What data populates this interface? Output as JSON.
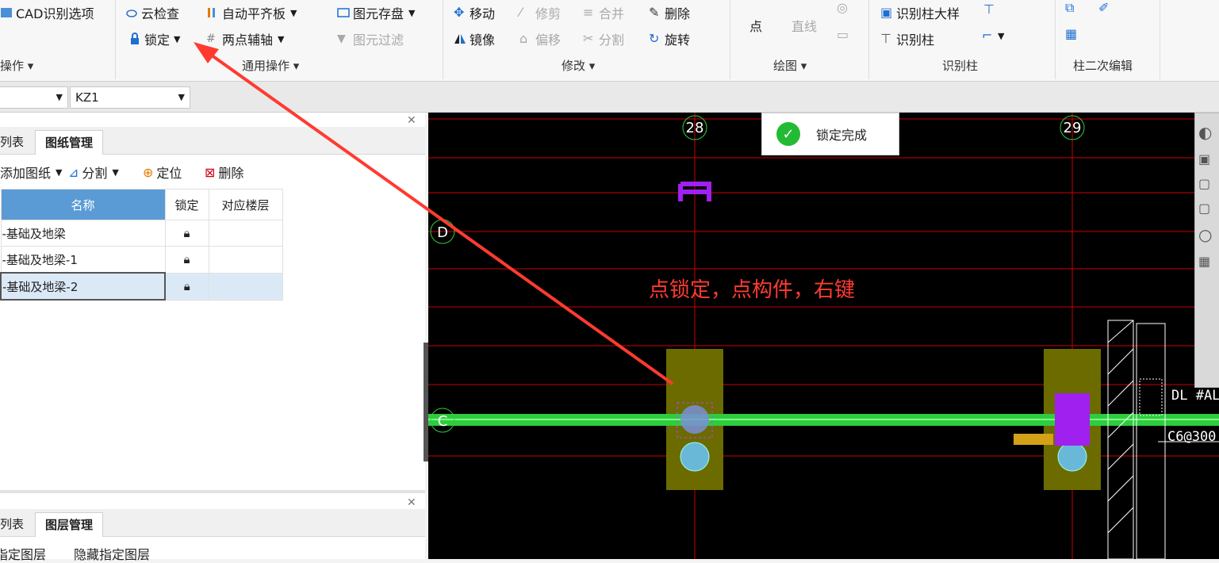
{
  "ribbon": {
    "col1": {
      "cad_options": "CAD识别选项",
      "group_partial": "操作"
    },
    "col2": {
      "cloud_check": "云检查",
      "lock": "锁定",
      "auto_align": "自动平齐板",
      "two_point_axis": "两点辅轴",
      "store_elements": "图元存盘",
      "filter_elements": "图元过滤",
      "group": "通用操作"
    },
    "modify": {
      "move": "移动",
      "trim": "修剪",
      "merge": "合并",
      "delete": "删除",
      "mirror": "镜像",
      "offset": "偏移",
      "split": "分割",
      "rotate": "旋转",
      "group": "修改"
    },
    "draw": {
      "point": "点",
      "line": "直线",
      "group": "绘图"
    },
    "recognize": {
      "column_detail": "识别柱大样",
      "column": "识别柱",
      "group": "识别柱"
    },
    "edit2": {
      "group": "柱二次编辑"
    }
  },
  "selector": {
    "component": "KZ1"
  },
  "drawings_panel": {
    "tab_list": "列表",
    "tab_manage": "图纸管理",
    "add": "添加图纸",
    "split": "分割",
    "locate": "定位",
    "delete": "删除",
    "headers": [
      "名称",
      "锁定",
      "对应楼层"
    ],
    "rows": [
      {
        "name": "基础及地梁",
        "locked": true,
        "floor": ""
      },
      {
        "name": "基础及地梁-1",
        "locked": true,
        "floor": ""
      },
      {
        "name": "基础及地梁-2",
        "locked": true,
        "floor": ""
      }
    ]
  },
  "layers_panel": {
    "tab_list": "列表",
    "tab_manage": "图层管理",
    "show_layer": "指定图层",
    "hide_layer": "隐藏指定图层"
  },
  "canvas": {
    "axes": {
      "a28": "28",
      "a29": "29",
      "d": "D",
      "c": "C"
    },
    "toast": "锁定完成",
    "annotation": "点锁定，点构件，右键",
    "cad_text1": "DL #AL",
    "cad_text2": "C6@300"
  },
  "colors": {
    "accent": "#5b9bd5",
    "annotation": "#ff3b30",
    "green_beam": "#2ecc40",
    "column_fill": "#6b6b00",
    "purple": "#9b00ff"
  }
}
